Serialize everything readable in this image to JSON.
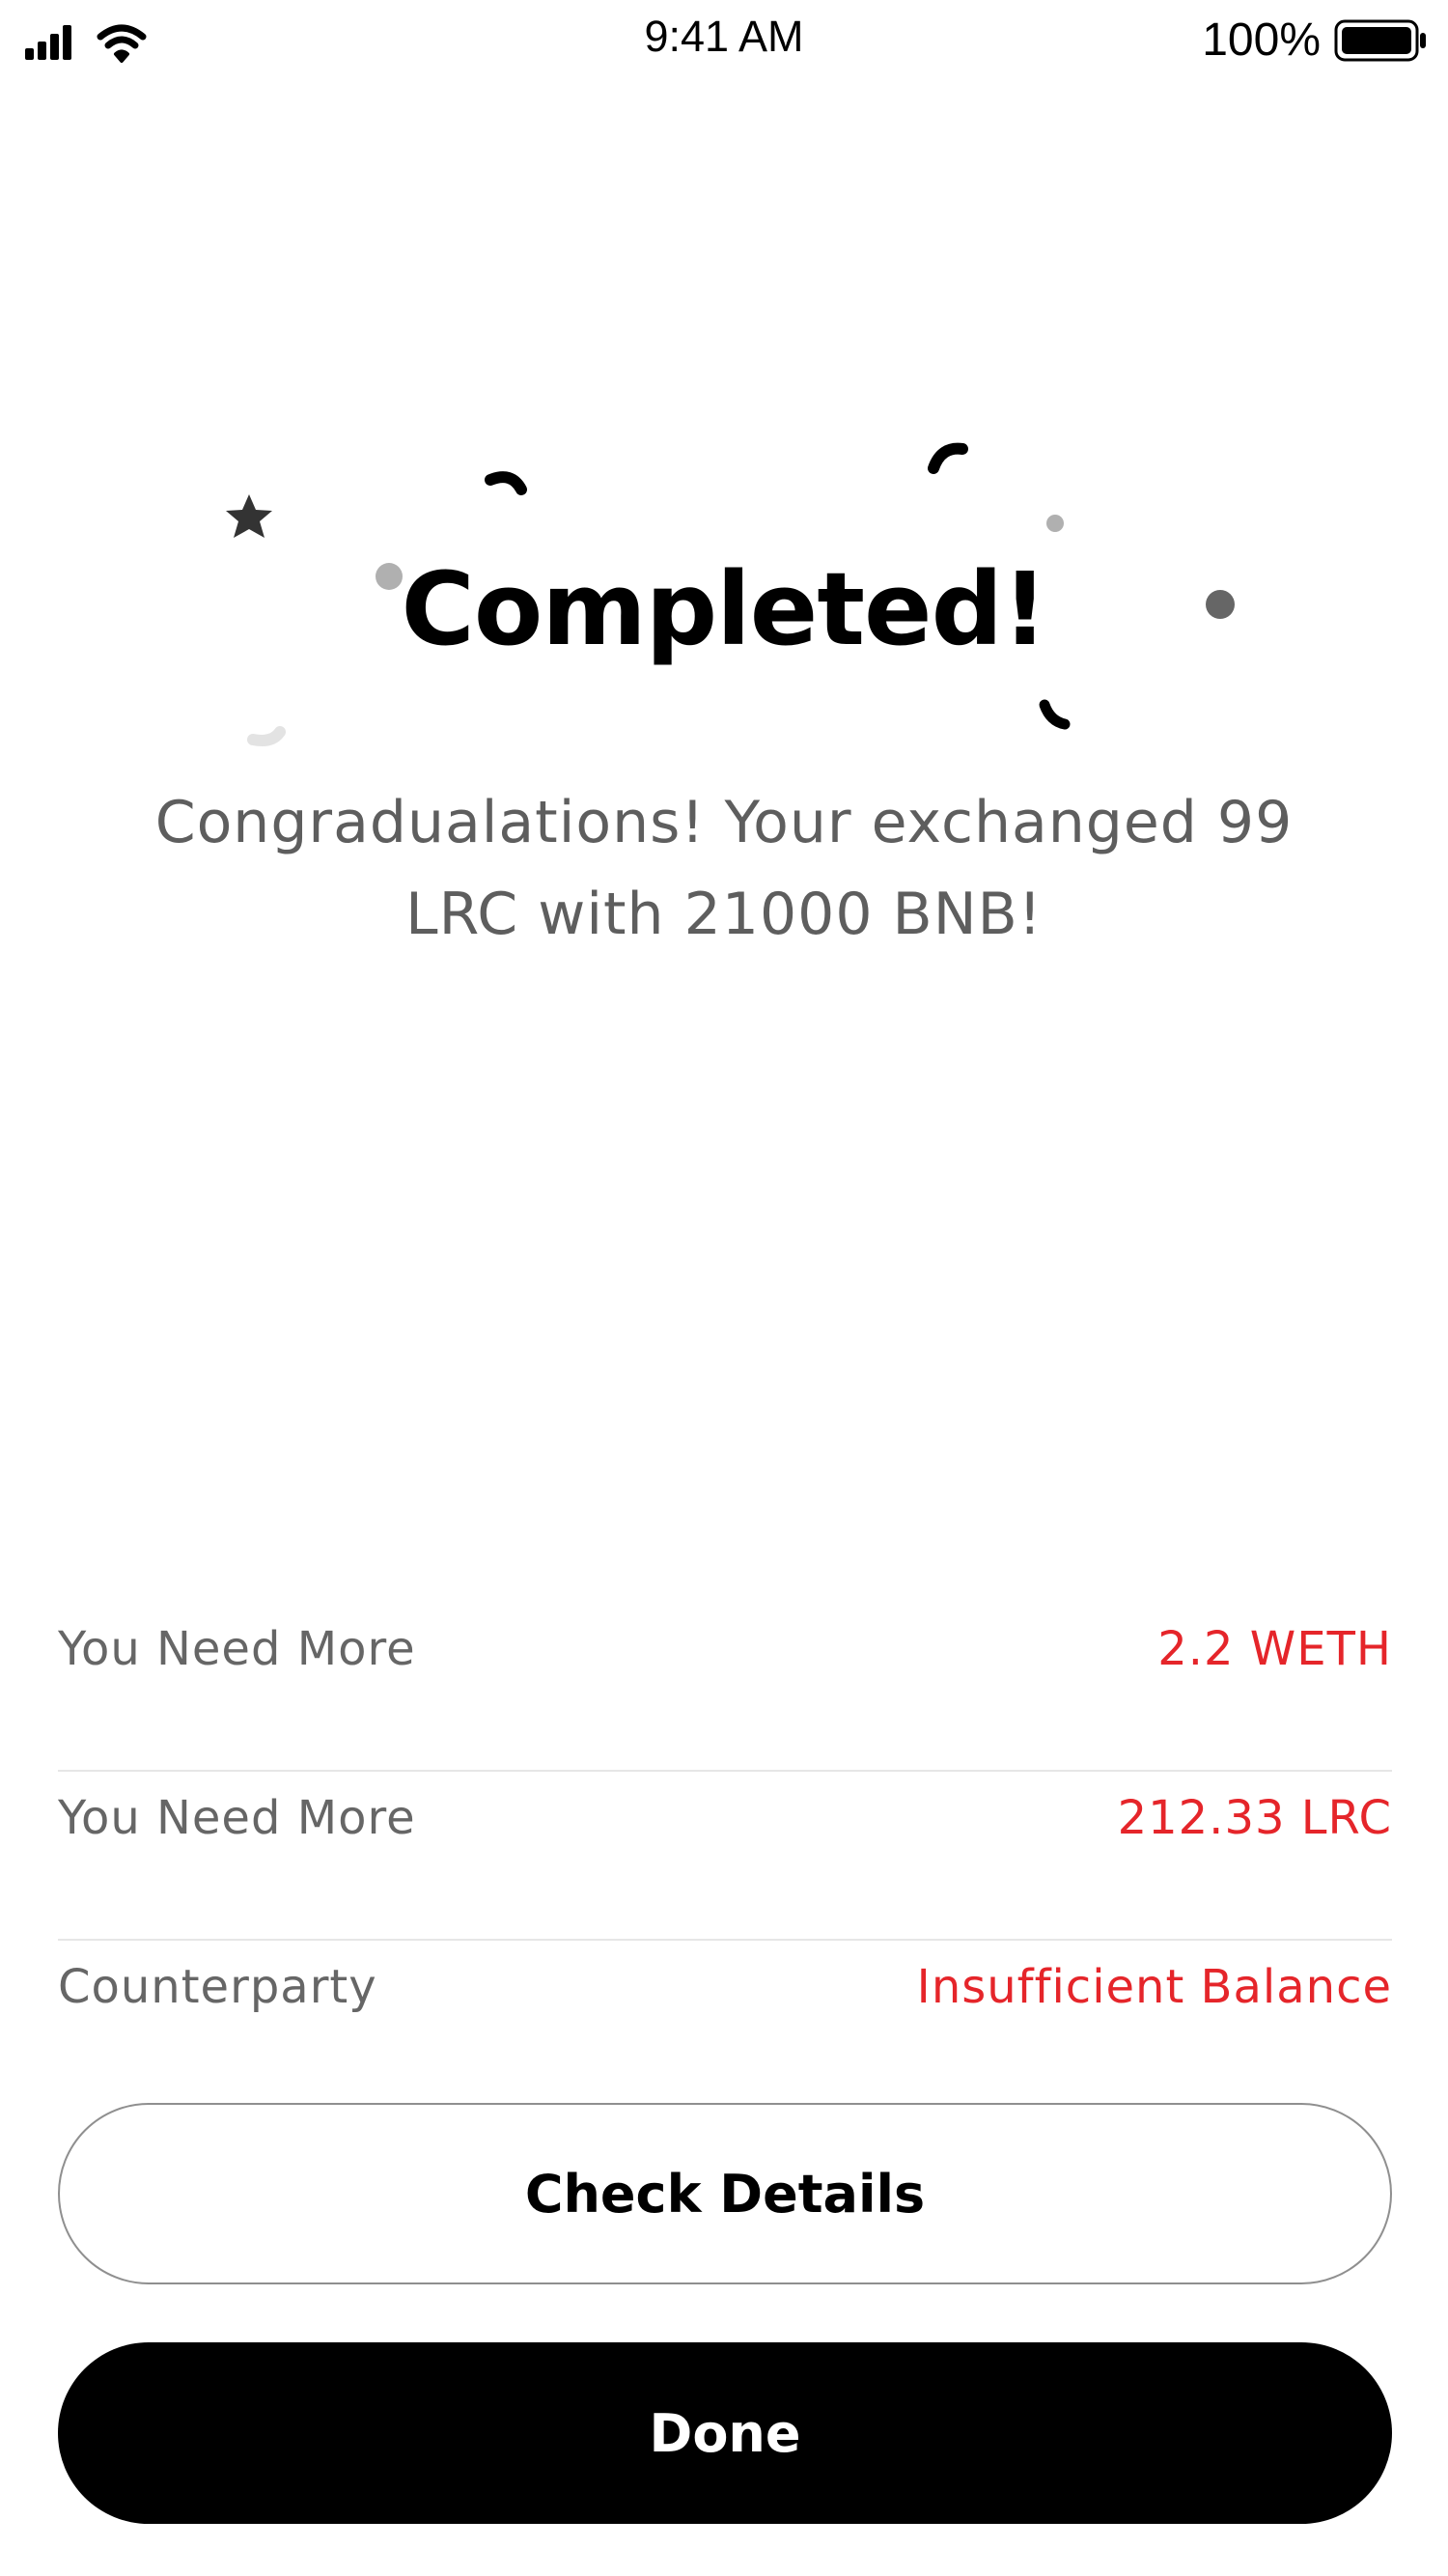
{
  "status_bar": {
    "time": "9:41 AM",
    "battery_percent": "100%",
    "battery_level": 1.0
  },
  "result": {
    "title": "Completed!",
    "message": "Congradualations!  Your exchanged 99 LRC with 21000 BNB!"
  },
  "details": [
    {
      "label": "You Need More",
      "value": "2.2 WETH"
    },
    {
      "label": "You Need More",
      "value": "212.33 LRC"
    },
    {
      "label": "Counterparty",
      "value": "Insufficient Balance"
    }
  ],
  "actions": {
    "check_details_label": "Check Details",
    "done_label": "Done"
  },
  "colors": {
    "accent_red": "#e5252a",
    "label_gray": "#666666",
    "primary": "#000000"
  }
}
